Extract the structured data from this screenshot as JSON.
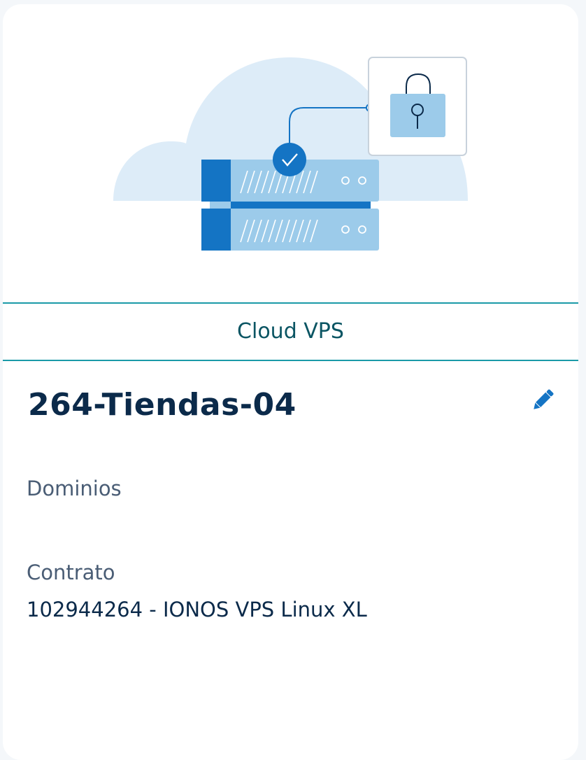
{
  "card": {
    "product_type": "Cloud VPS",
    "server_name": "264-Tiendas-04",
    "fields": {
      "domains_label": "Dominios",
      "contract_label": "Contrato",
      "contract_value": "102944264 - IONOS VPS Linux XL"
    }
  },
  "icons": {
    "edit": "pencil-icon",
    "illustration": "cloud-server-lock-illustration"
  },
  "colors": {
    "accent_line": "#1a9aa8",
    "product_type_text": "#0b5563",
    "title_text": "#0b2a4a",
    "label_text": "#4a5d75",
    "brand_blue": "#1474c4",
    "light_blue": "#9ccbea",
    "cloud": "#ddecf8"
  }
}
